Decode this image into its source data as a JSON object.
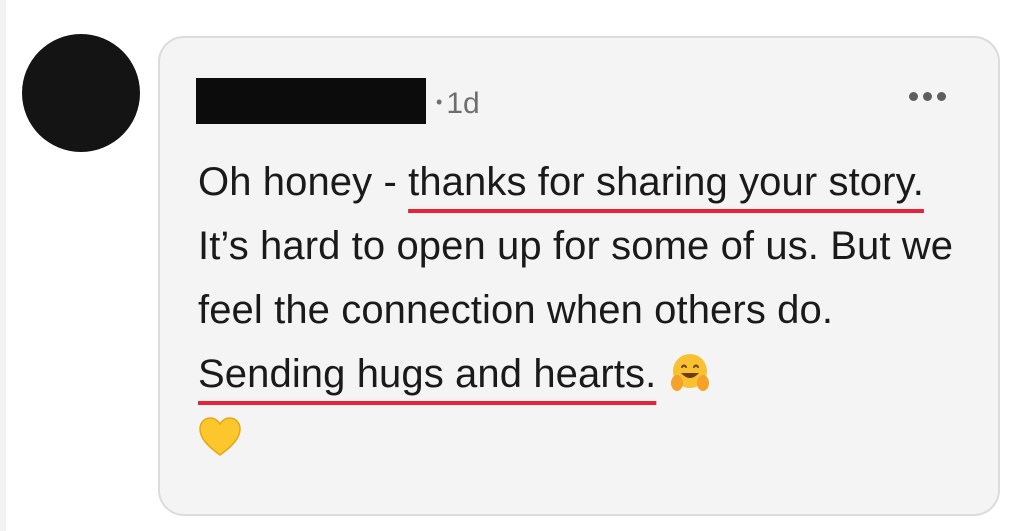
{
  "comment": {
    "timestamp": "1d",
    "separator": "•",
    "text_parts": {
      "p1": "Oh honey - ",
      "h1": "thanks for sharing your story.",
      "p2": " It’s hard to open up for some of us. But we feel the connection when others do. ",
      "h2": "Sending hugs and hearts."
    },
    "emojis": [
      "hugging-face-icon",
      "yellow-heart-icon"
    ],
    "highlight_color": "#e5243a"
  },
  "menu": {
    "icon": "more-horizontal-icon"
  },
  "author": {
    "name_redacted": true,
    "avatar": "avatar"
  }
}
